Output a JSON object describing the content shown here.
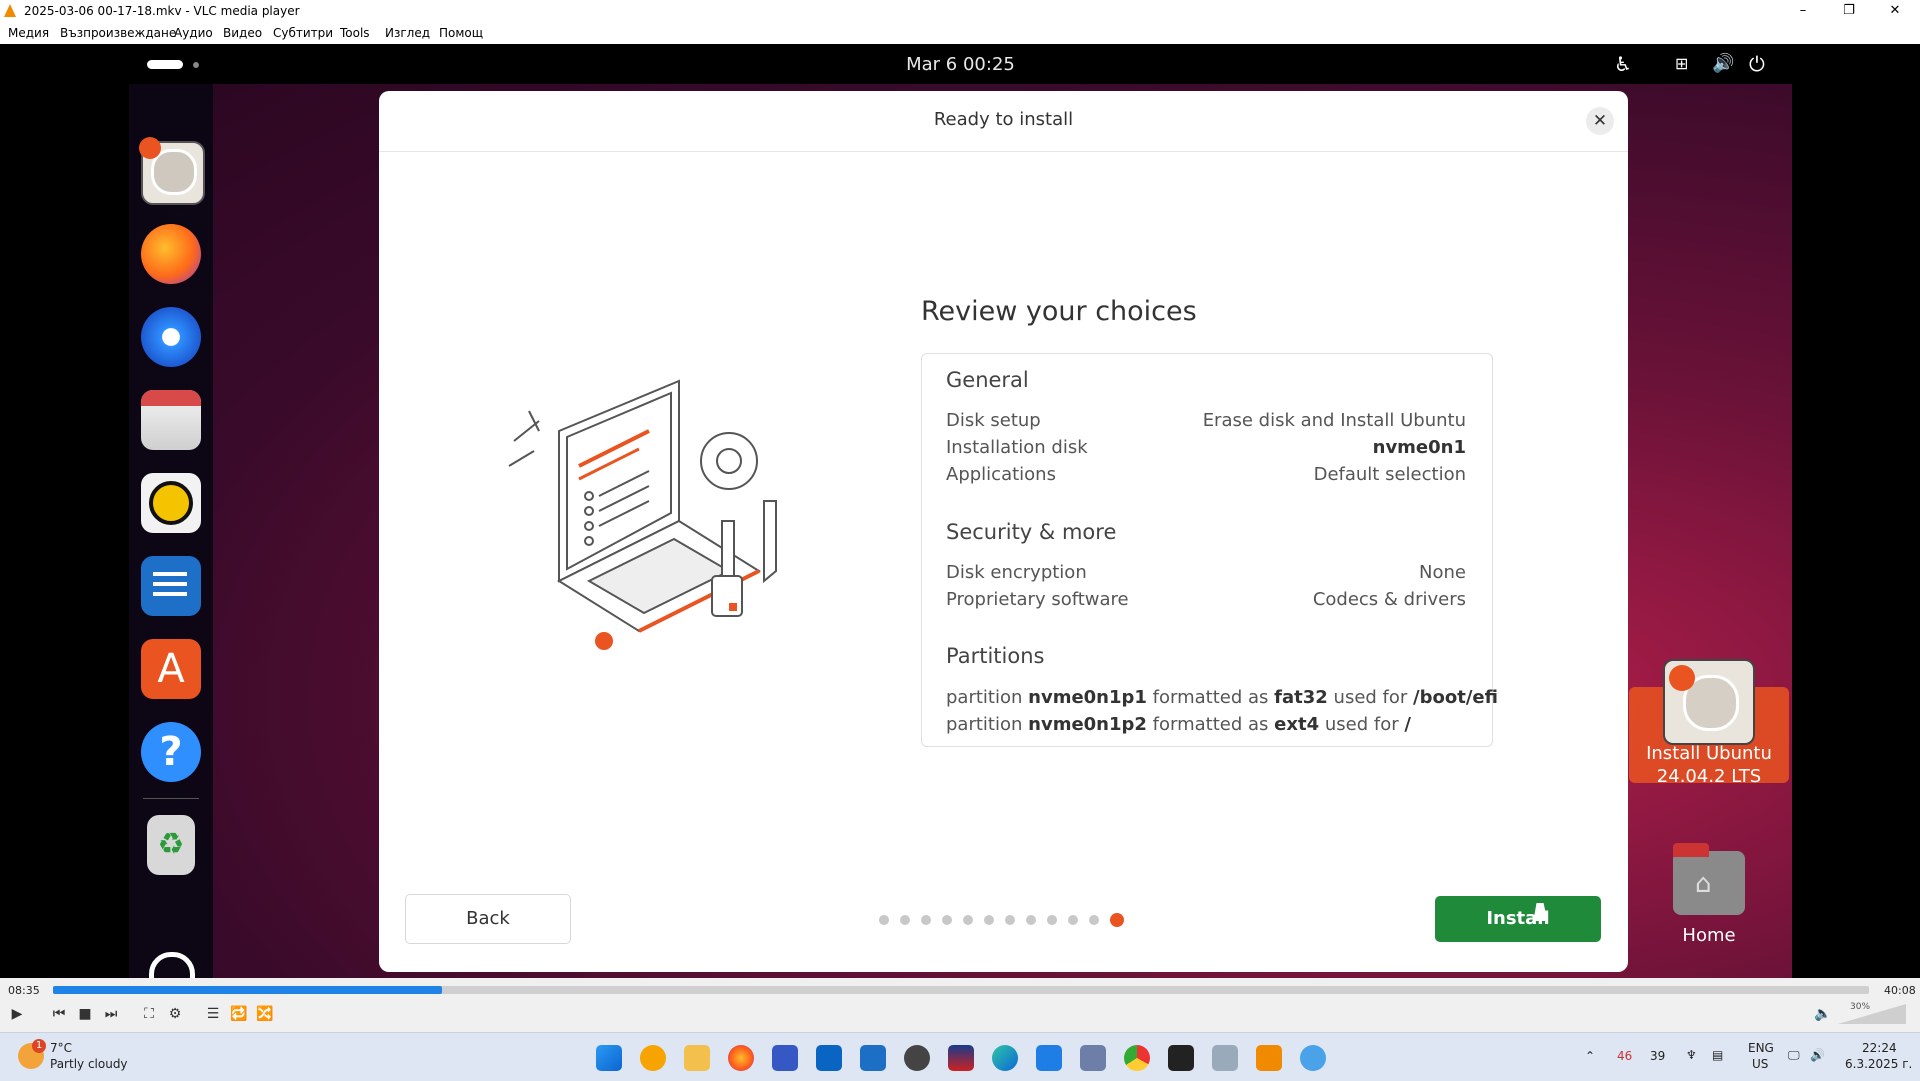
{
  "window": {
    "title": "2025-03-06 00-17-18.mkv - VLC media player",
    "controls": [
      "–",
      "❐",
      "✕"
    ]
  },
  "menu": [
    "Медия",
    "Възпроизвеждане",
    "Аудио",
    "Видео",
    "Субтитри",
    "Tools",
    "Изглед",
    "Помощ"
  ],
  "ubuntu": {
    "topbar": {
      "clock": "Mar 6  00:25"
    },
    "dock_icons": [
      "installer-icon",
      "firefox-icon",
      "thunderbird-icon",
      "files-icon",
      "rhythmbox-icon",
      "writer-icon",
      "app-center-icon",
      "help-icon",
      "trash-icon",
      "show-apps-icon"
    ],
    "dialog": {
      "title": "Ready to install",
      "heading": "Review your choices",
      "general": {
        "title": "General",
        "rows": [
          {
            "label": "Disk setup",
            "value": "Erase disk and Install Ubuntu"
          },
          {
            "label": "Installation disk",
            "value": "nvme0n1"
          },
          {
            "label": "Applications",
            "value": "Default selection"
          }
        ]
      },
      "security": {
        "title": "Security & more",
        "rows": [
          {
            "label": "Disk encryption",
            "value": "None"
          },
          {
            "label": "Proprietary software",
            "value": "Codecs & drivers"
          }
        ]
      },
      "partitions": {
        "title": "Partitions",
        "rows": [
          {
            "w1": "partition",
            "dev": "nvme0n1p1",
            "w2": "formatted as",
            "fs": "fat32",
            "w3": "used for",
            "mount": "/boot/efi"
          },
          {
            "w1": "partition",
            "dev": "nvme0n1p2",
            "w2": "formatted as",
            "fs": "ext4",
            "w3": "used for",
            "mount": "/"
          }
        ]
      },
      "back_label": "Back",
      "install_label": "Install",
      "progress": {
        "steps": 12,
        "current": 12
      }
    },
    "desktop": {
      "installer_line1": "Install Ubuntu",
      "installer_line2": "24.04.2 LTS",
      "home": "Home"
    }
  },
  "player": {
    "elapsed": "08:35",
    "total": "40:08",
    "progress_fraction": 0.214,
    "volume": "30%"
  },
  "taskbar": {
    "weather_temp": "7°C",
    "weather_desc": "Partly cloudy",
    "weather_badge": "1",
    "tray_num1": "46",
    "tray_num2": "39",
    "lang1": "ENG",
    "lang2": "US",
    "time": "22:24",
    "date": "6.3.2025 г."
  }
}
